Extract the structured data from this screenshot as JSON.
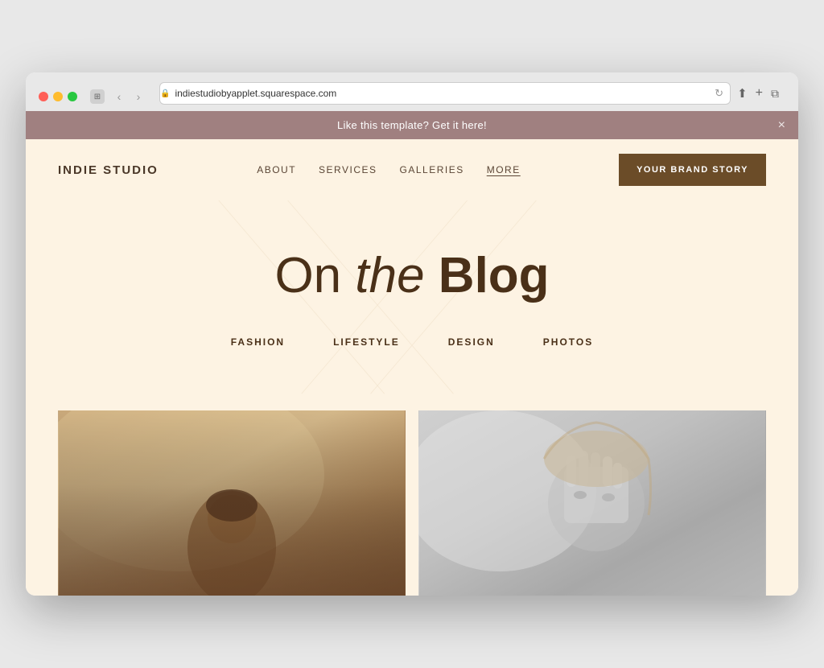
{
  "browser": {
    "url": "indiestudiobyapplet.squarespace.com",
    "traffic_lights": [
      "red",
      "yellow",
      "green"
    ]
  },
  "banner": {
    "text": "Like this template? Get it here!",
    "close_label": "×"
  },
  "nav": {
    "logo": "INDIE STUDIO",
    "links": [
      {
        "label": "ABOUT",
        "active": false
      },
      {
        "label": "SERVICES",
        "active": false
      },
      {
        "label": "GALLERIES",
        "active": false
      },
      {
        "label": "MORE",
        "active": true
      }
    ],
    "cta": "YOUR BRAND STORY"
  },
  "hero": {
    "title_part1": "On ",
    "title_italic": "the",
    "title_part2": " Blog"
  },
  "blog_categories": [
    {
      "label": "FASHION"
    },
    {
      "label": "LIFESTYLE"
    },
    {
      "label": "DESIGN"
    },
    {
      "label": "PHOTOS"
    }
  ],
  "cards": [
    {
      "id": "card-1",
      "type": "warm"
    },
    {
      "id": "card-2",
      "type": "bw"
    }
  ],
  "colors": {
    "background": "#fdf3e3",
    "banner_bg": "#a08080",
    "nav_text": "#4a3728",
    "hero_text": "#4a3018",
    "cta_bg": "#6b4c28",
    "accent": "#6b4c28"
  }
}
